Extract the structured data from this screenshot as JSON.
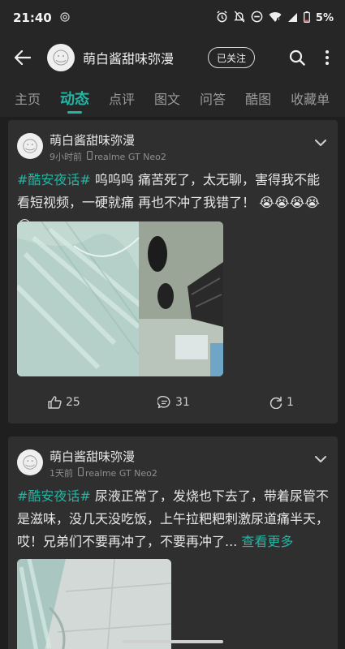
{
  "status_bar": {
    "time": "21:40",
    "notification_icon": "at-icon",
    "battery": "5%",
    "icons": [
      "alarm-icon",
      "mute-icon",
      "dnd-icon",
      "wifi-icon",
      "signal-icon",
      "battery-low-icon"
    ]
  },
  "header": {
    "user_name": "萌白酱甜味弥漫",
    "follow_label": "已关注"
  },
  "tabs": [
    {
      "label": "主页",
      "active": false
    },
    {
      "label": "动态",
      "active": true
    },
    {
      "label": "点评",
      "active": false
    },
    {
      "label": "图文",
      "active": false
    },
    {
      "label": "问答",
      "active": false
    },
    {
      "label": "酷图",
      "active": false
    },
    {
      "label": "收藏单",
      "active": false
    }
  ],
  "posts": [
    {
      "author": "萌白酱甜味弥漫",
      "time": "9小时前",
      "device": "realme GT Neo2",
      "tag": "#酷安夜话#",
      "text": " 呜呜呜 痛苦死了，太无聊，害得我不能看短视频，一硬就痛 再也不冲了我错了！ 😭😭😭😭😭",
      "likes": "25",
      "comments": "31",
      "shares": "1"
    },
    {
      "author": "萌白酱甜味弥漫",
      "time": "1天前",
      "device": "realme GT Neo2",
      "tag": "#酷安夜话#",
      "text": " 尿液正常了，发烧也下去了，带着尿管不是滋味，没几天没吃饭，上午拉粑粑刺激尿道痛半天，哎！兄弟们不要再冲了，不要再冲了...",
      "more_label": " 查看更多"
    }
  ],
  "colors": {
    "accent": "#22b5a3",
    "background": "#1f1f1f",
    "card": "#2f2f2f",
    "battery_low": "#e5534b"
  }
}
